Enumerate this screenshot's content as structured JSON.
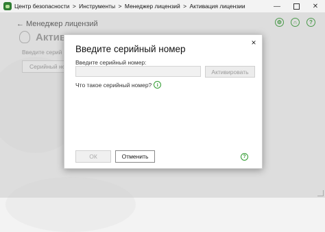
{
  "titlebar": {
    "breadcrumb": [
      "Центр безопасности",
      "Инструменты",
      "Менеджер лицензий",
      "Активация лицензии"
    ],
    "separator": ">",
    "controls": [
      "minimize",
      "maximize",
      "close"
    ]
  },
  "background": {
    "back_label": "Менеджер лицензий",
    "heading": "Активац",
    "field_label": "Введите серий",
    "input_value": "Серийный но"
  },
  "dialog": {
    "title": "Введите серийный номер",
    "close_icon": "×",
    "field_label": "Введите серийный номер:",
    "serial_value": "",
    "activate_label": "Активировать",
    "help_text": "Что такое серийный номер?",
    "ok_label": "ОК",
    "cancel_label": "Отменить",
    "colors": {
      "accent": "#2f9a2f"
    }
  },
  "icons": {
    "settings": "gear-icon",
    "support": "headset-icon",
    "help": "question-icon",
    "info": "info-icon"
  }
}
